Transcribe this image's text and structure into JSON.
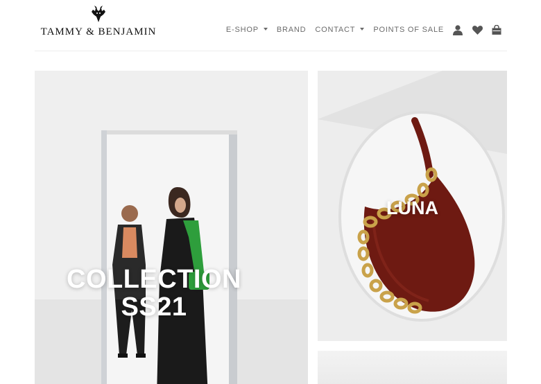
{
  "brand": {
    "name": "TAMMY & BENJAMIN"
  },
  "nav": {
    "items": [
      {
        "label": "E-SHOP",
        "dropdown": true
      },
      {
        "label": "BRAND",
        "dropdown": false
      },
      {
        "label": "CONTACT",
        "dropdown": true
      },
      {
        "label": "POINTS OF SALE",
        "dropdown": false
      }
    ],
    "icons": [
      "user-icon",
      "heart-icon",
      "shopping-bag-icon"
    ]
  },
  "banners": {
    "collection": {
      "line1": "COLLECTION",
      "line2": "SS21"
    },
    "luna": {
      "title": "LUNA"
    }
  },
  "colors": {
    "nav_text": "#6b6b6b",
    "icon": "#555555",
    "bag_red": "#6e1a12",
    "chain_gold": "#c9a24a",
    "green_bag": "#2e9e3c"
  }
}
